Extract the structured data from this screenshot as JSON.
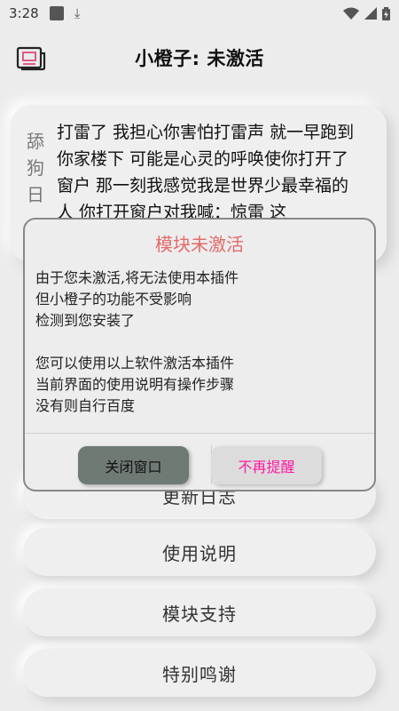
{
  "status_bar": {
    "time": "3:28"
  },
  "header": {
    "title": "小橙子: 未激活"
  },
  "card": {
    "vertical_label": [
      "舔",
      "狗",
      "日"
    ],
    "verse": "打雷了 我担心你害怕打雷声 就一早跑到你家楼下 可能是心灵的呼唤使你打开了窗户 那一刻我感觉我是世界少最幸福的人 你打开窗户对我喊：惊雷 这"
  },
  "menu": {
    "hidden_item": "更新日志",
    "items": [
      "使用说明",
      "模块支持",
      "特别鸣谢"
    ]
  },
  "dialog": {
    "title": "模块未激活",
    "lines_1": [
      "由于您未激活,将无法使用本插件",
      "但小橙子的功能不受影响",
      "检测到您安装了"
    ],
    "lines_2": [
      "您可以使用以上软件激活本插件",
      "当前界面的使用说明有操作步骤",
      "没有则自行百度"
    ],
    "close_label": "关闭窗口",
    "nomore_label": "不再提醒"
  },
  "colors": {
    "dialog_title": "#e46a6a",
    "nomore_text": "#ff1aa0",
    "close_button_bg": "#6f7a74"
  }
}
